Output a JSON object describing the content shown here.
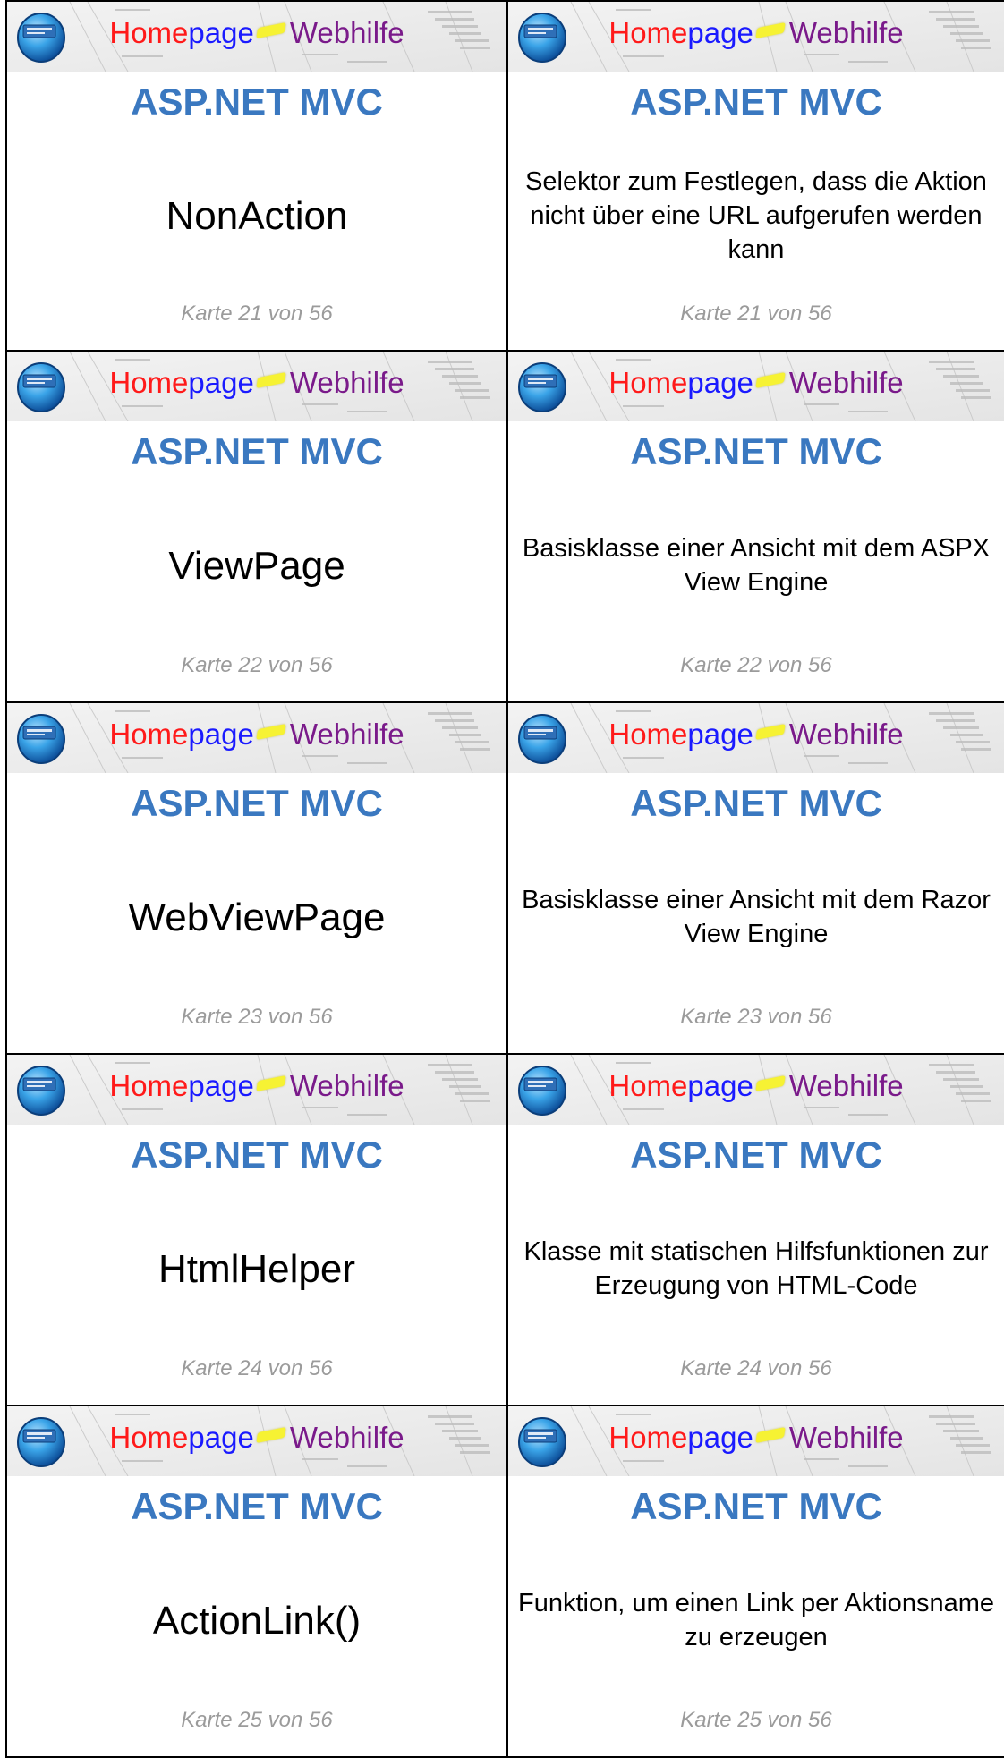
{
  "brand": {
    "home": "Home",
    "page": "page",
    "web": "Web",
    "hilfe": "hilfe",
    "logo_icon": "homepage-globe-icon"
  },
  "cards": [
    {
      "subject": "ASP.NET MVC",
      "term": "NonAction",
      "definition": "Selektor zum Festlegen, dass die Aktion nicht über eine URL aufgerufen werden kann",
      "footer": "Karte 21 von 56"
    },
    {
      "subject": "ASP.NET MVC",
      "term": "ViewPage",
      "definition": "Basisklasse einer Ansicht mit dem ASPX View Engine",
      "footer": "Karte 22 von 56"
    },
    {
      "subject": "ASP.NET MVC",
      "term": "WebViewPage",
      "definition": "Basisklasse einer Ansicht mit dem Razor View Engine",
      "footer": "Karte 23 von 56"
    },
    {
      "subject": "ASP.NET MVC",
      "term": "HtmlHelper",
      "definition": "Klasse mit statischen Hilfsfunktionen zur Erzeugung von HTML-Code",
      "footer": "Karte 24 von 56"
    },
    {
      "subject": "ASP.NET MVC",
      "term": "ActionLink()",
      "definition": "Funktion, um einen Link per Aktionsname zu erzeugen",
      "footer": "Karte 25 von 56"
    }
  ]
}
